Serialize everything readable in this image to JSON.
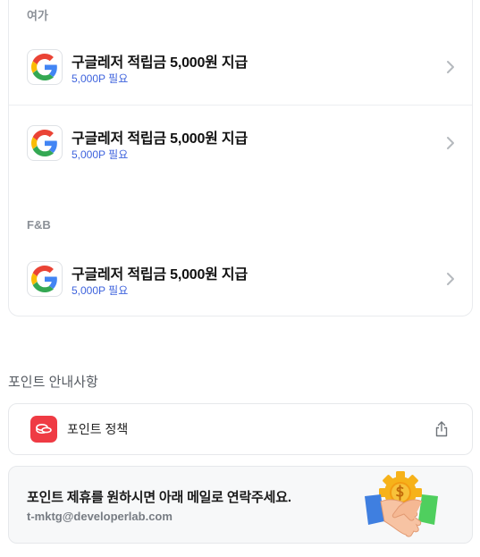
{
  "sections": [
    {
      "label": "여가",
      "items": [
        {
          "title": "구글레저 적립금 5,000원 지급",
          "sub": "5,000P 필요",
          "icon": "google-logo-icon"
        },
        {
          "title": "구글레저 적립금 5,000원 지급",
          "sub": "5,000P 필요",
          "icon": "google-logo-icon"
        }
      ]
    },
    {
      "label": "F&B",
      "items": [
        {
          "title": "구글레저 적립금 5,000원 지급",
          "sub": "5,000P 필요",
          "icon": "google-logo-icon"
        }
      ]
    }
  ],
  "info": {
    "title": "포인트 안내사항",
    "policy_label": "포인트 정책"
  },
  "contact": {
    "text": "포인트 제휴를 원하시면 아래 메일로 연락주세요.",
    "email": "t-mktg@developerlab.com"
  },
  "colors": {
    "accent_blue": "#3e63dd",
    "policy_red": "#ef3b44"
  }
}
